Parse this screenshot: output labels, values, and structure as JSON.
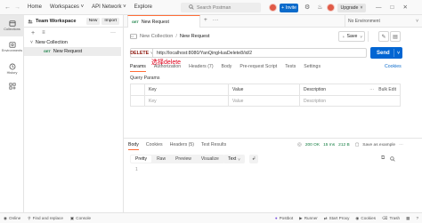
{
  "topbar": {
    "nav": [
      "Home",
      "Workspaces",
      "API Network",
      "Explore"
    ],
    "search_placeholder": "Search Postman",
    "invite_label": "Invite",
    "upgrade_label": "Upgrade"
  },
  "rail": {
    "items": [
      "Collections",
      "Environments",
      "History"
    ]
  },
  "sidebar": {
    "workspace_name": "Team Workspace",
    "new_label": "New",
    "import_label": "Import",
    "collection_name": "New Collection",
    "request_method": "GET",
    "request_name": "New Request"
  },
  "tab": {
    "method": "GET",
    "title": "New Request",
    "environment": "No Environment"
  },
  "request": {
    "breadcrumb_parent": "New Collection",
    "breadcrumb_sep": "/",
    "breadcrumb_current": "New Request",
    "save_label": "Save",
    "method": "DELETE",
    "url": "http://localhost:8080/YanQingHuaDelete8/id/2",
    "send_label": "Send",
    "annotation": "选择delete",
    "tabs": [
      "Params",
      "Authorization",
      "Headers (7)",
      "Body",
      "Pre-request Script",
      "Tests",
      "Settings"
    ],
    "cookies_label": "Cookies",
    "query_params_label": "Query Params",
    "table_headers": [
      "Key",
      "Value",
      "Description"
    ],
    "bulk_edit": "Bulk Edit",
    "row_placeholders": [
      "Key",
      "Value",
      "Description"
    ]
  },
  "response": {
    "tabs": [
      "Body",
      "Cookies",
      "Headers (5)",
      "Test Results"
    ],
    "status": "200 OK",
    "time": "15 ms",
    "size": "212 B",
    "save_example": "Save as example",
    "formats": [
      "Pretty",
      "Raw",
      "Preview",
      "Visualize"
    ],
    "text_type": "Text",
    "line_number": "1"
  },
  "statusbar": {
    "left": [
      "Online",
      "Find and replace",
      "Console"
    ],
    "right": [
      "Postbot",
      "Runner",
      "Start Proxy",
      "Cookies",
      "Trash"
    ]
  },
  "colors": {
    "accent": "#ff6c37",
    "send": "#0265d2",
    "delete_method": "#8e1a10",
    "status_ok": "#0f7b3e",
    "annotation": "#e0001b"
  }
}
